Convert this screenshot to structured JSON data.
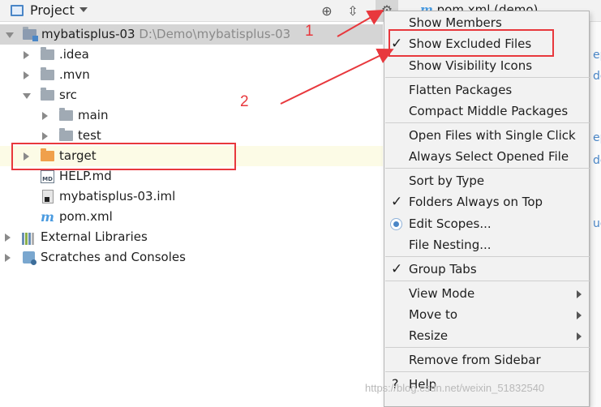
{
  "header": {
    "title": "Project",
    "editor_tab": "pom.xml (demo)"
  },
  "tree": {
    "root": {
      "name": "mybatisplus-03",
      "path": "D:\\Demo\\mybatisplus-03"
    },
    "items": [
      {
        "label": ".idea"
      },
      {
        "label": ".mvn"
      },
      {
        "label": "src"
      },
      {
        "label": "main"
      },
      {
        "label": "test"
      },
      {
        "label": "target"
      },
      {
        "label": "HELP.md"
      },
      {
        "label": "mybatisplus-03.iml"
      },
      {
        "label": "pom.xml"
      },
      {
        "label": "External Libraries"
      },
      {
        "label": "Scratches and Consoles"
      }
    ],
    "md_badge": "MD",
    "m_badge": "m"
  },
  "annotations": {
    "one": "1",
    "two": "2"
  },
  "menu": {
    "items": [
      {
        "label": "Show Members"
      },
      {
        "label": "Show Excluded Files",
        "checked": true
      },
      {
        "label": "Show Visibility Icons"
      },
      {
        "label": "Flatten Packages"
      },
      {
        "label": "Compact Middle Packages"
      },
      {
        "label": "Open Files with Single Click"
      },
      {
        "label": "Always Select Opened File"
      },
      {
        "label": "Sort by Type"
      },
      {
        "label": "Folders Always on Top",
        "checked": true
      },
      {
        "label": "Edit Scopes..."
      },
      {
        "label": "File Nesting..."
      },
      {
        "label": "Group Tabs",
        "checked": true
      },
      {
        "label": "View Mode"
      },
      {
        "label": "Move to"
      },
      {
        "label": "Resize"
      },
      {
        "label": "Remove from Sidebar"
      },
      {
        "label": "Help"
      }
    ],
    "check_glyph": "✓",
    "help_glyph": "?"
  },
  "editor_marks": [
    "ep",
    "de",
    "ep",
    "de",
    "ug"
  ],
  "watermark": "https://blog.csdn.net/weixin_51832540",
  "colors": {
    "accent": "#4a86c7",
    "annotation": "#e8383d",
    "target_folder": "#f0a04b"
  }
}
